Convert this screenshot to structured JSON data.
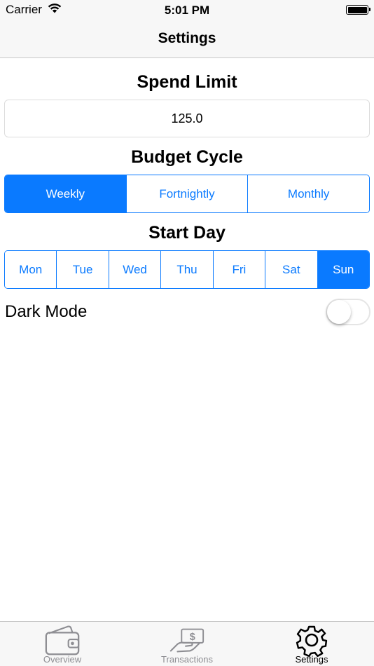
{
  "status_bar": {
    "carrier": "Carrier",
    "time": "5:01 PM"
  },
  "nav": {
    "title": "Settings"
  },
  "spend_limit": {
    "title": "Spend Limit",
    "value": "125.0"
  },
  "budget_cycle": {
    "title": "Budget Cycle",
    "options": [
      "Weekly",
      "Fortnightly",
      "Monthly"
    ],
    "selected": "Weekly"
  },
  "start_day": {
    "title": "Start Day",
    "options": [
      "Mon",
      "Tue",
      "Wed",
      "Thu",
      "Fri",
      "Sat",
      "Sun"
    ],
    "selected": "Sun"
  },
  "dark_mode": {
    "label": "Dark Mode",
    "enabled": false
  },
  "tab_bar": {
    "items": [
      {
        "label": "Overview",
        "icon": "wallet-icon",
        "active": false
      },
      {
        "label": "Transactions",
        "icon": "hand-money-icon",
        "active": false
      },
      {
        "label": "Settings",
        "icon": "gear-icon",
        "active": true
      }
    ]
  },
  "colors": {
    "accent": "#0a7aff",
    "bar_background": "#f7f7f7",
    "inactive_tab": "#8e8e93"
  }
}
